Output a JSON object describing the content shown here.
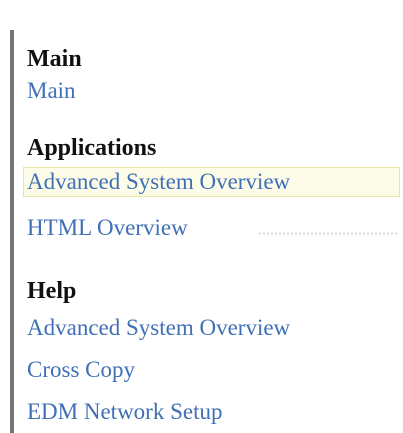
{
  "nav": {
    "main": {
      "heading": "Main",
      "items": [
        {
          "label": "Main"
        }
      ]
    },
    "applications": {
      "heading": "Applications",
      "items": [
        {
          "label": "Advanced System Overview"
        },
        {
          "label": "HTML Overview"
        }
      ]
    },
    "help": {
      "heading": "Help",
      "items": [
        {
          "label": "Advanced System Overview"
        },
        {
          "label": "Cross Copy"
        },
        {
          "label": "EDM Network Setup"
        }
      ]
    }
  },
  "colors": {
    "link": "#3f6fb5",
    "heading": "#111111",
    "border": "#767676",
    "highlight": "#fcfce8"
  }
}
